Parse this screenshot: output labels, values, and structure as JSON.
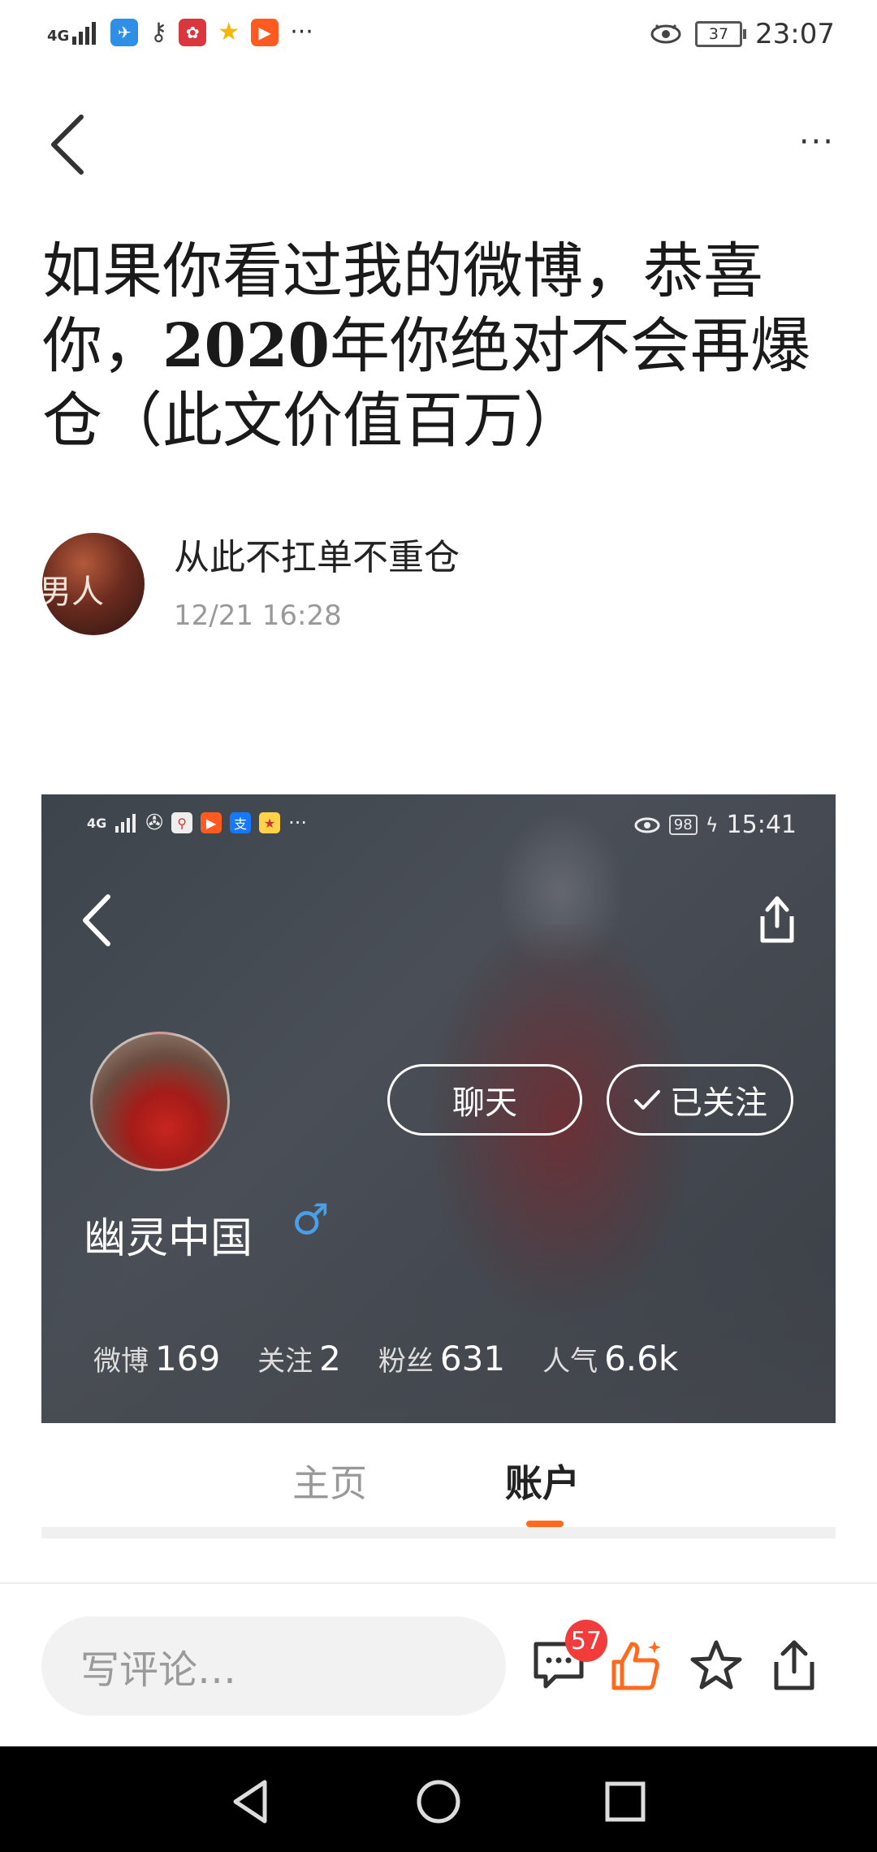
{
  "status_bar": {
    "network": "4G",
    "time": "23:07",
    "battery": "37",
    "more": "···"
  },
  "nav": {
    "more": "···"
  },
  "article": {
    "title_part1": "如果你看过我的微博，恭喜你，",
    "title_bold": "2020",
    "title_part2": "年你绝对不会再爆仓（此文价值百万）"
  },
  "author": {
    "avatar_text": "男人",
    "name": "从此不扛单不重仓",
    "time": "12/21 16:28"
  },
  "embedded_screenshot": {
    "status_network": "4G",
    "status_more": "···",
    "status_battery": "98",
    "status_time": "15:41",
    "username": "幽灵中国",
    "gender_symbol": "♂",
    "chat_label": "聊天",
    "follow_label": "已关注",
    "stats": [
      {
        "label": "微博",
        "value": "169"
      },
      {
        "label": "关注",
        "value": "2"
      },
      {
        "label": "粉丝",
        "value": "631"
      },
      {
        "label": "人气",
        "value": "6.6k"
      }
    ]
  },
  "tabs": {
    "home": "主页",
    "account": "账户"
  },
  "bottom_bar": {
    "comment_placeholder": "写评论…",
    "comment_count": "57"
  },
  "colors": {
    "accent": "#ff6a1e",
    "badge": "#f23b3b",
    "gender": "#4aa0e8"
  }
}
